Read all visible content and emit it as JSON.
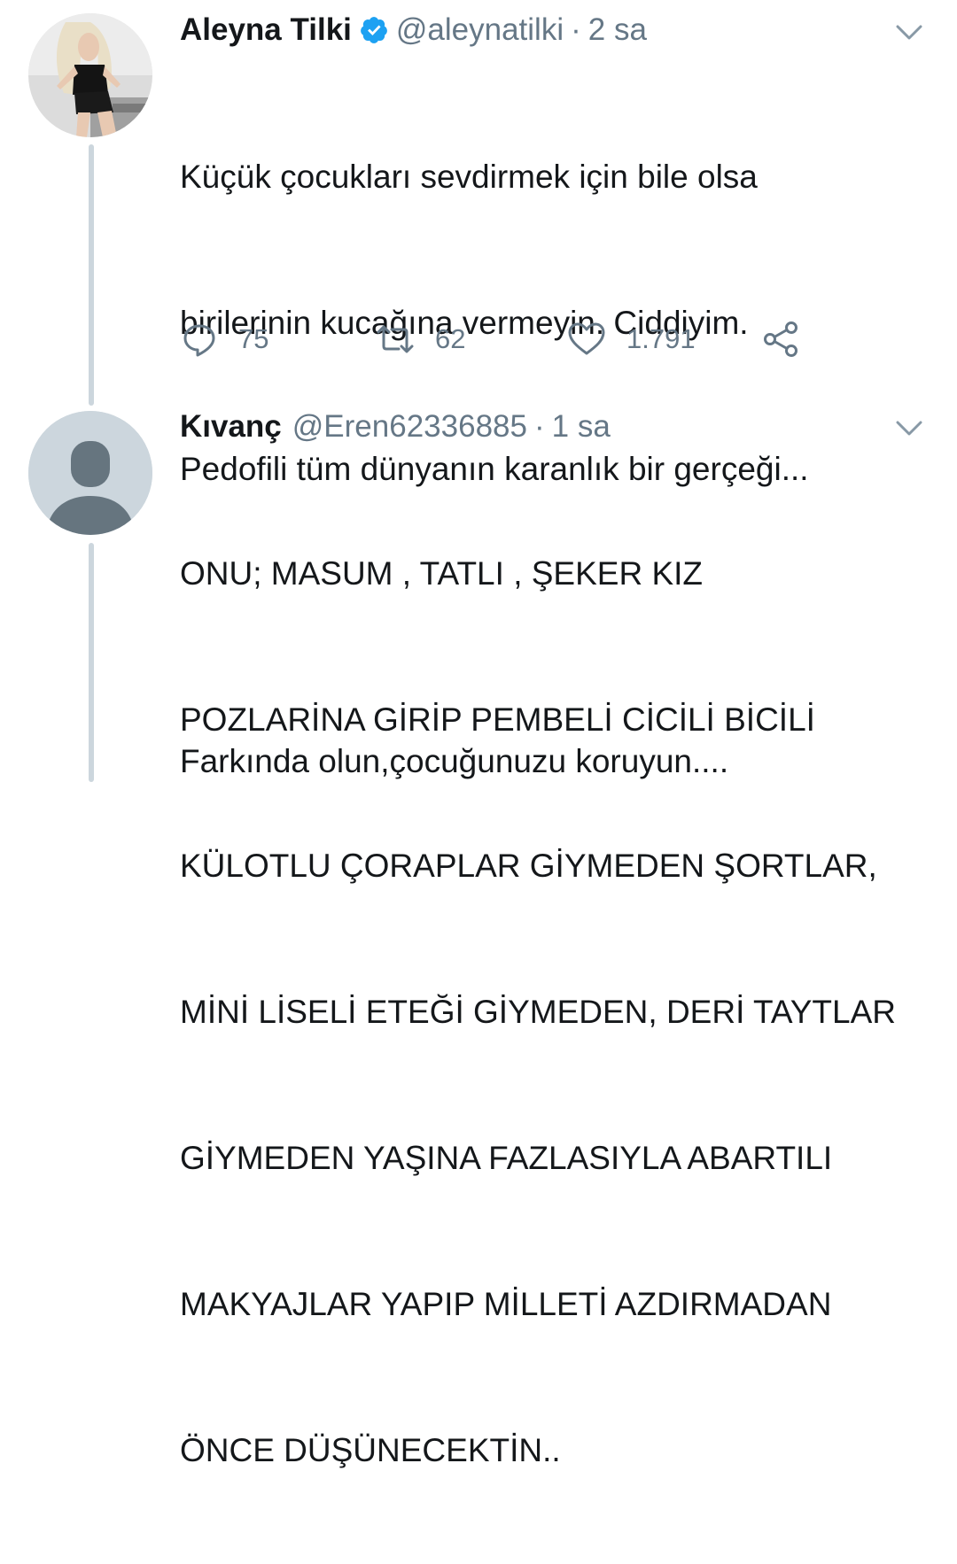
{
  "tweet": {
    "author_name": "Aleyna Tilki",
    "handle": "@aleynatilki",
    "separator": "·",
    "time": "2 sa",
    "text_lines": [
      "Küçük çocukları sevdirmek için bile olsa",
      "birilerinin kucağına vermeyin. Ciddiyim.",
      "Pedofili tüm dünyanın karanlık bir gerçeği...",
      "",
      "Farkında olun,çocuğunuzu koruyun...."
    ],
    "replies": "75",
    "retweets": "62",
    "likes": "1.791"
  },
  "reply": {
    "author_name": "Kıvanç",
    "handle": "@Eren62336885",
    "separator": "·",
    "time": "1 sa",
    "text_lines": [
      "ONU; MASUM , TATLI , ŞEKER KIZ",
      "POZLARİNA GİRİP PEMBELİ CİCİLİ BİCİLİ",
      "KÜLOTLU ÇORAPLAR GİYMEDEN ŞORTLAR,",
      "MİNİ LİSELİ ETEĞİ GİYMEDEN, DERİ TAYTLAR",
      "GİYMEDEN YAŞINA FAZLASIYLA ABARTILI",
      "MAKYAJLAR YAPIP MİLLETİ AZDIRMADAN",
      "ÖNCE DÜŞÜNECEKTİN.."
    ]
  },
  "icons": {
    "verified": "verified-badge-icon",
    "caret": "chevron-down-icon",
    "reply": "reply-icon",
    "retweet": "retweet-icon",
    "like": "heart-icon",
    "share": "share-icon"
  },
  "colors": {
    "text": "#14171a",
    "secondary": "#657786",
    "verified": "#1da1f2",
    "thread_line": "#ccd6dd",
    "default_avatar_bg": "#ccd6dd",
    "default_avatar_fg": "#66757f"
  }
}
